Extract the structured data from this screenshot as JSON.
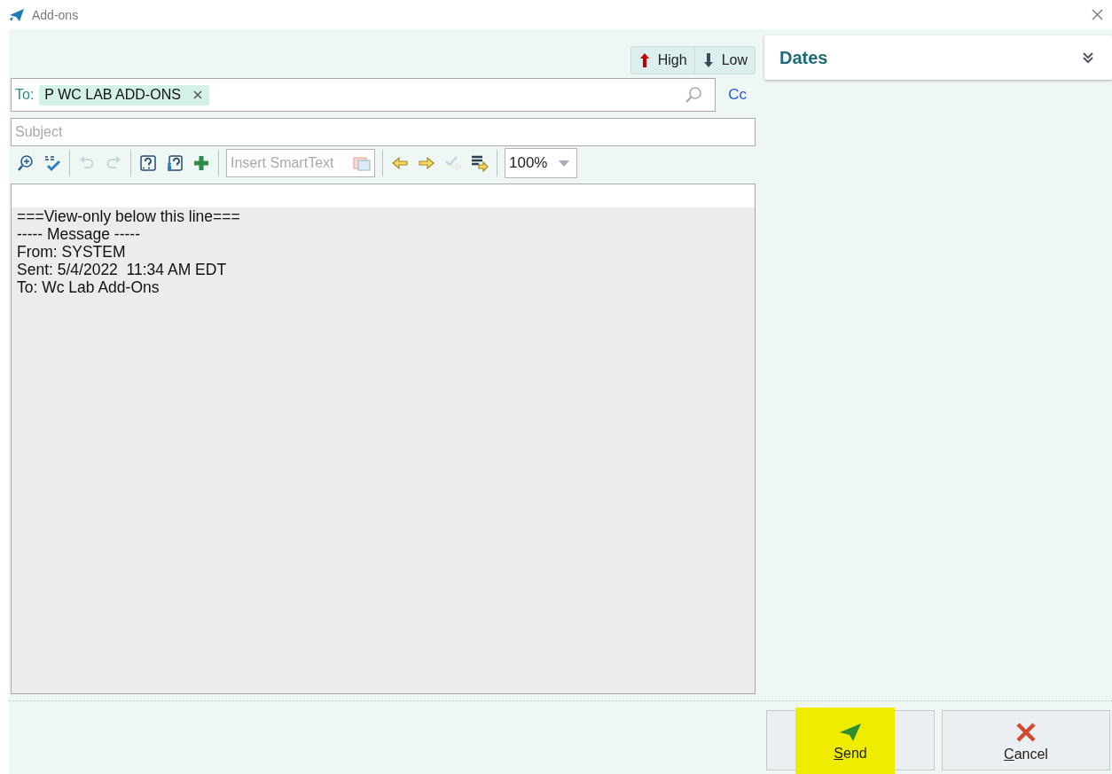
{
  "window": {
    "title": "Add-ons"
  },
  "priority": [
    {
      "label": "High",
      "kind": "high"
    },
    {
      "label": "Low",
      "kind": "low"
    }
  ],
  "to": {
    "label": "To:",
    "recipients": [
      {
        "name": "P WC LAB ADD-ONS"
      }
    ]
  },
  "cc": "Cc",
  "subject": {
    "placeholder": "Subject"
  },
  "tools": [
    {
      "kind": "zoom-in",
      "disabled": false
    },
    {
      "kind": "spell",
      "disabled": false
    },
    {
      "kind": "sep"
    },
    {
      "kind": "undo",
      "disabled": true
    },
    {
      "kind": "redo",
      "disabled": true
    },
    {
      "kind": "sep"
    },
    {
      "kind": "help",
      "disabled": false
    },
    {
      "kind": "help-person",
      "disabled": false
    },
    {
      "kind": "plus",
      "disabled": false
    },
    {
      "kind": "sep"
    },
    {
      "kind": "smarttext",
      "placeholder": "Insert SmartText"
    },
    {
      "kind": "sep"
    },
    {
      "kind": "prev",
      "disabled": false
    },
    {
      "kind": "next",
      "disabled": false
    },
    {
      "kind": "check-next",
      "disabled": true
    },
    {
      "kind": "list-next",
      "disabled": false
    },
    {
      "kind": "sep"
    },
    {
      "kind": "zoom-select",
      "value": "100%"
    }
  ],
  "body": {
    "lines": [
      "===View-only below this line===",
      "----- Message -----",
      "From: SYSTEM",
      "Sent: 5/4/2022  11:34 AM EDT",
      "To: Wc Lab Add-Ons"
    ]
  },
  "dates": {
    "title": "Dates",
    "expanded": false
  },
  "buttons": [
    {
      "label": "Send",
      "kind": "send",
      "highlighted": true
    },
    {
      "label": "Cancel",
      "kind": "cancel",
      "highlighted": false
    }
  ]
}
